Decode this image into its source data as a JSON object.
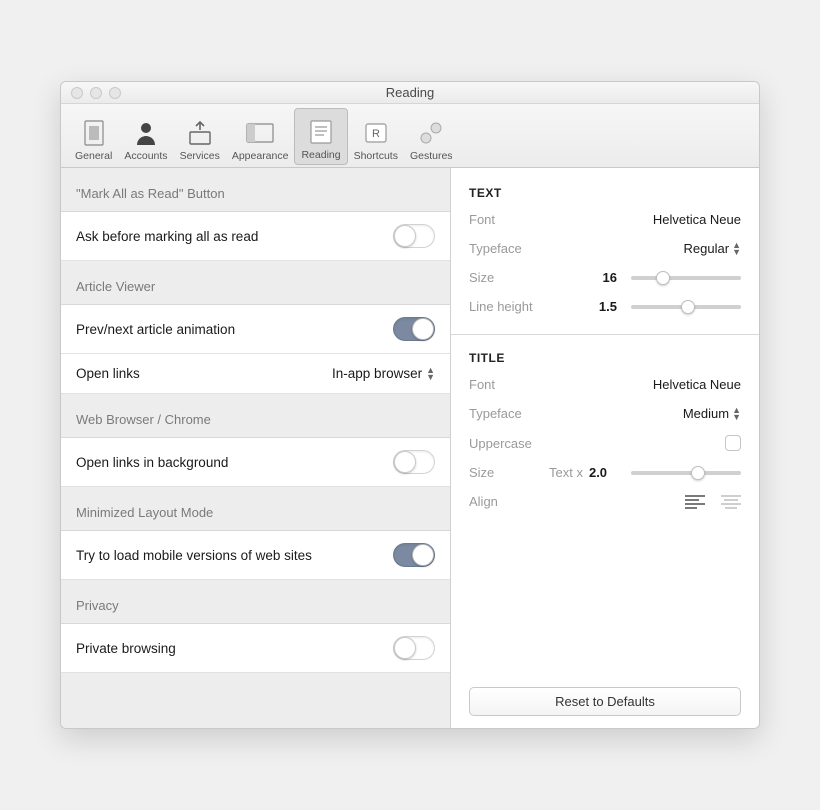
{
  "window": {
    "title": "Reading"
  },
  "toolbar": {
    "items": [
      {
        "label": "General"
      },
      {
        "label": "Accounts"
      },
      {
        "label": "Services"
      },
      {
        "label": "Appearance"
      },
      {
        "label": "Reading"
      },
      {
        "label": "Shortcuts"
      },
      {
        "label": "Gestures"
      }
    ]
  },
  "left": {
    "sections": [
      {
        "header": "\"Mark All as Read\" Button",
        "rows": [
          {
            "label": "Ask before marking all as read",
            "type": "toggle",
            "on": false
          }
        ]
      },
      {
        "header": "Article Viewer",
        "rows": [
          {
            "label": "Prev/next article animation",
            "type": "toggle",
            "on": true
          },
          {
            "label": "Open links",
            "type": "select",
            "value": "In-app browser"
          }
        ]
      },
      {
        "header": "Web Browser / Chrome",
        "rows": [
          {
            "label": "Open links in background",
            "type": "toggle",
            "on": false
          }
        ]
      },
      {
        "header": "Minimized Layout Mode",
        "rows": [
          {
            "label": "Try to load mobile versions of web sites",
            "type": "toggle",
            "on": true
          }
        ]
      },
      {
        "header": "Privacy",
        "rows": [
          {
            "label": "Private browsing",
            "type": "toggle",
            "on": false
          }
        ]
      }
    ]
  },
  "right": {
    "text": {
      "heading": "TEXT",
      "font_label": "Font",
      "font_value": "Helvetica Neue",
      "typeface_label": "Typeface",
      "typeface_value": "Regular",
      "size_label": "Size",
      "size_value": "16",
      "lineheight_label": "Line height",
      "lineheight_value": "1.5"
    },
    "title": {
      "heading": "TITLE",
      "font_label": "Font",
      "font_value": "Helvetica Neue",
      "typeface_label": "Typeface",
      "typeface_value": "Medium",
      "uppercase_label": "Uppercase",
      "size_label": "Size",
      "size_prefix": "Text x",
      "size_value": "2.0",
      "align_label": "Align"
    },
    "reset": "Reset to Defaults"
  }
}
